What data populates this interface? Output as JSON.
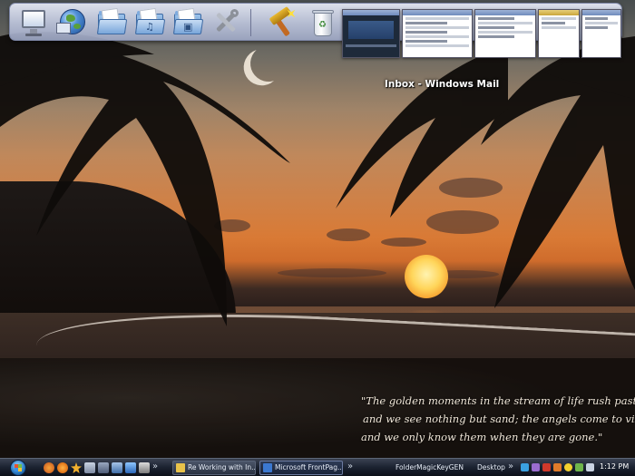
{
  "dock": {
    "icons": [
      "computer-icon",
      "network-globe-icon",
      "documents-folder-icon",
      "music-folder-icon",
      "pictures-folder-icon",
      "tools-icon",
      "cleanup-tool-icon",
      "recycle-bin-icon"
    ],
    "preview_caption": "Inbox - Windows Mail"
  },
  "quote": {
    "line1": "\"The golden moments in the stream of life rush past us",
    "line2": "and we see nothing but sand; the angels come to visit us,",
    "line3": "and we only know them when they are gone.\""
  },
  "taskbar": {
    "quick_launch_chevron": "»",
    "tasks_chevron": "»",
    "tasks": [
      {
        "label": "Re Working with In...",
        "icon": "mail-icon",
        "color": "#e9c34a",
        "active": false
      },
      {
        "label": "Microsoft FrontPag...",
        "icon": "frontpage-icon",
        "color": "#3b78d0",
        "active": true
      }
    ],
    "toolbar_label": "FolderMagicKeyGEN",
    "desktop_label": "Desktop",
    "desktop_chevron": "»",
    "clock": "1:12 PM"
  }
}
